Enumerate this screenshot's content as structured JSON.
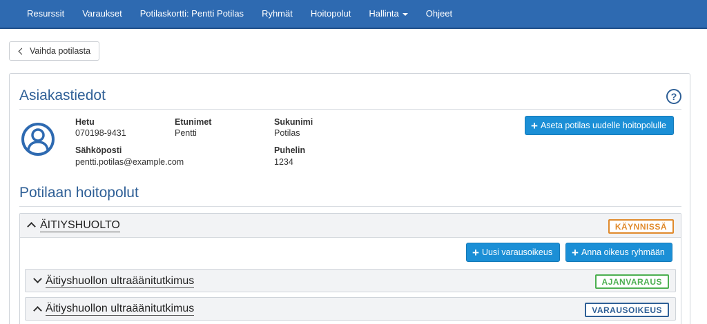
{
  "nav": {
    "items": [
      {
        "label": "Resurssit"
      },
      {
        "label": "Varaukset"
      },
      {
        "label": "Potilaskortti: Pentti Potilas"
      },
      {
        "label": "Ryhmät"
      },
      {
        "label": "Hoitopolut"
      },
      {
        "label": "Hallinta"
      },
      {
        "label": "Ohjeet"
      }
    ]
  },
  "back_button": {
    "label": "Vaihda potilasta"
  },
  "customer": {
    "title": "Asiakastiedot",
    "help": "?",
    "fields": {
      "hetu": {
        "label": "Hetu",
        "value": "070198-9431"
      },
      "etunimet": {
        "label": "Etunimet",
        "value": "Pentti"
      },
      "sukunimi": {
        "label": "Sukunimi",
        "value": "Potilas"
      },
      "email": {
        "label": "Sähköposti",
        "value": "pentti.potilas@example.com"
      },
      "puhelin": {
        "label": "Puhelin",
        "value": "1234"
      }
    },
    "assign_button": "Aseta potilas uudelle hoitopolulle"
  },
  "pathways": {
    "title": "Potilaan hoitopolut",
    "group": {
      "title": "ÄITIYSHUOLTO",
      "status": "KÄYNNISSÄ",
      "status_color": "#e08a2c",
      "new_reservation_button": "Uusi varausoikeus",
      "give_group_button": "Anna oikeus ryhmään",
      "items": [
        {
          "title": "Äitiyshuollon ultraäänitutkimus",
          "status": "AJANVARAUS",
          "status_color": "#4caf50"
        },
        {
          "title": "Äitiyshuollon ultraäänitutkimus",
          "status": "VARAUSOIKEUS",
          "status_color": "#2e5f96"
        }
      ]
    }
  }
}
